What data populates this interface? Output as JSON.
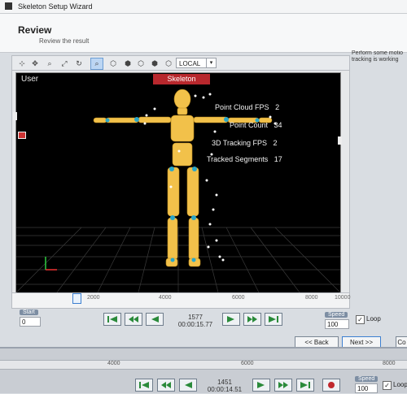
{
  "window": {
    "title": "Skeleton Setup Wizard"
  },
  "header": {
    "title": "Review",
    "subtitle": "Review the result"
  },
  "help_text": [
    "Perform some motio",
    "tracking is working"
  ],
  "toolbar": {
    "mode_value": "LOCAL"
  },
  "viewport": {
    "label": "User",
    "skeleton_tag": "Skeleton",
    "stats": [
      {
        "label": "Point Cloud FPS",
        "value": "2"
      },
      {
        "label": "Point Count",
        "value": "34"
      },
      {
        "label": "3D Tracking FPS",
        "value": "2"
      },
      {
        "label": "Tracked Segments",
        "value": "17"
      }
    ]
  },
  "timeline": {
    "ticks": [
      "2000",
      "4000",
      "6000",
      "8000",
      "10000"
    ]
  },
  "playback": {
    "start_label": "Start",
    "start_value": "0",
    "frame": "1577",
    "time": "00:00:15.77",
    "speed_label": "Speed",
    "speed_value": "100",
    "loop_label": "Loop",
    "loop_checked": true
  },
  "nav": {
    "back": "<< Back",
    "next": "Next >>",
    "partial": "Co"
  },
  "lower": {
    "ticks": [
      "4000",
      "6000",
      "8000"
    ],
    "frame": "1451",
    "time": "00:00:14.51",
    "speed_label": "Speed",
    "speed_value": "100",
    "loop_label": "Loop"
  }
}
